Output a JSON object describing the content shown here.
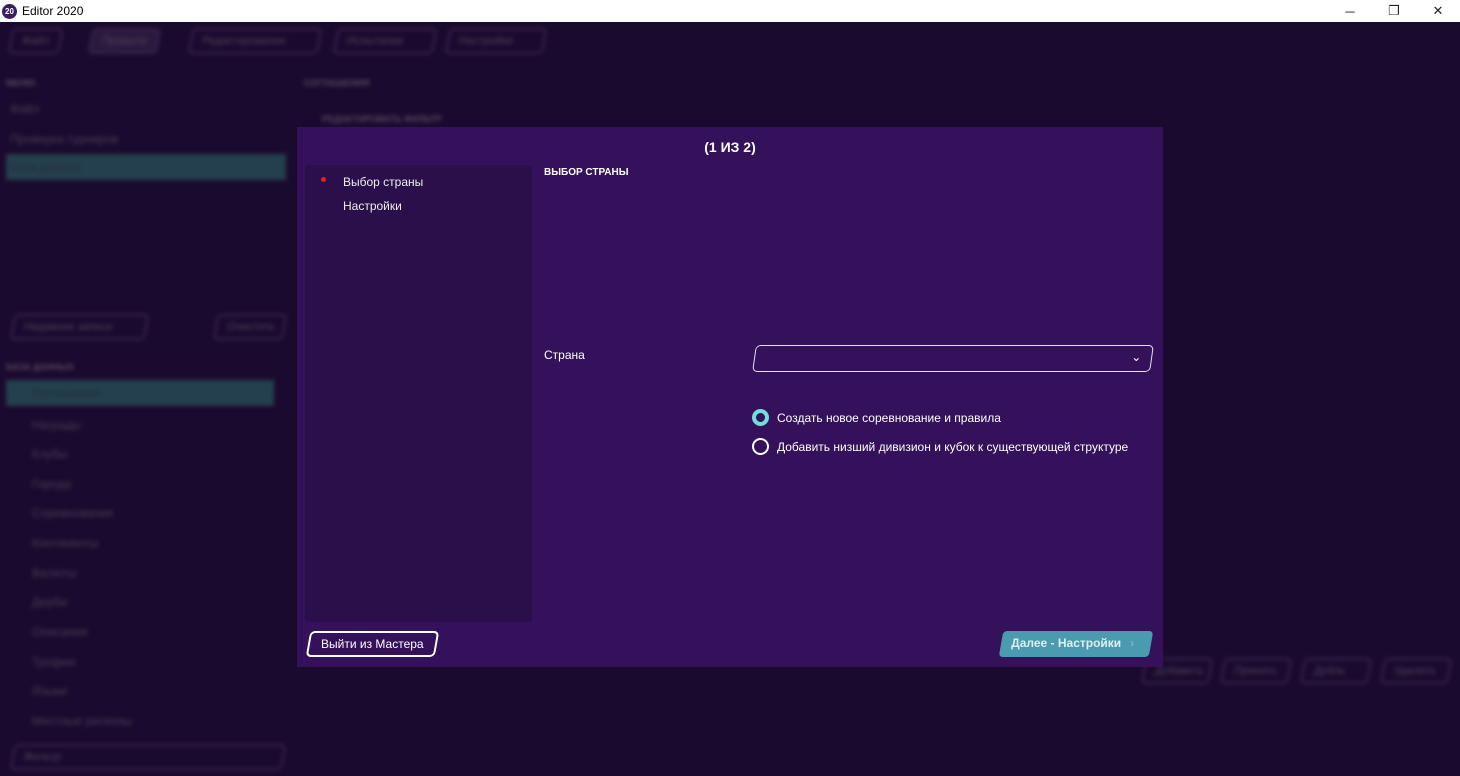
{
  "window": {
    "title": "Editor 2020",
    "icon_text": "20",
    "minimize": "─",
    "restore": "❐",
    "close": "✕"
  },
  "background": {
    "toolbar": [
      "Файл",
      "Правила",
      "Редактирование",
      "Испытание",
      "Настройки"
    ],
    "menu_header": "МЕНЮ",
    "menu_items": [
      "Файл",
      "Проверка турниров",
      "База данных"
    ],
    "recent": "Недавние записи",
    "clear": "Очистить",
    "db_header": "БАЗА ДАННЫХ",
    "db_items": [
      "Соглашения",
      "Награды",
      "Клубы",
      "Города",
      "Соревнования",
      "Континенты",
      "Валюты",
      "Дерби",
      "Описания",
      "Трофеи",
      "Языки",
      "Местные регионы"
    ],
    "filter": "Фильтр",
    "content_header": "СОГЛАШЕНИЯ",
    "content_sub": "РЕДАКТИРОВАТЬ ФИЛЬТР",
    "bottom_buttons": [
      "Добавить",
      "Принять",
      "Дубль",
      "Удалить"
    ]
  },
  "wizard": {
    "title": "(1 ИЗ 2)",
    "steps": [
      {
        "label": "Выбор страны",
        "active": true
      },
      {
        "label": "Настройки",
        "active": false
      }
    ],
    "section_title": "ВЫБОР СТРАНЫ",
    "country_label": "Страна",
    "country_value": "",
    "options": [
      {
        "label": "Создать новое соревнование и правила",
        "selected": true
      },
      {
        "label": "Добавить низший дивизион и кубок к существующей структуре",
        "selected": false
      }
    ],
    "exit_label": "Выйти из Мастера",
    "next_label": "Далее - Настройки",
    "next_arrow": "›"
  },
  "colors": {
    "accent": "#6fe0d8",
    "next_button": "#4a9bb0",
    "active_dot": "#e02020",
    "selection": "#3aa38c"
  }
}
